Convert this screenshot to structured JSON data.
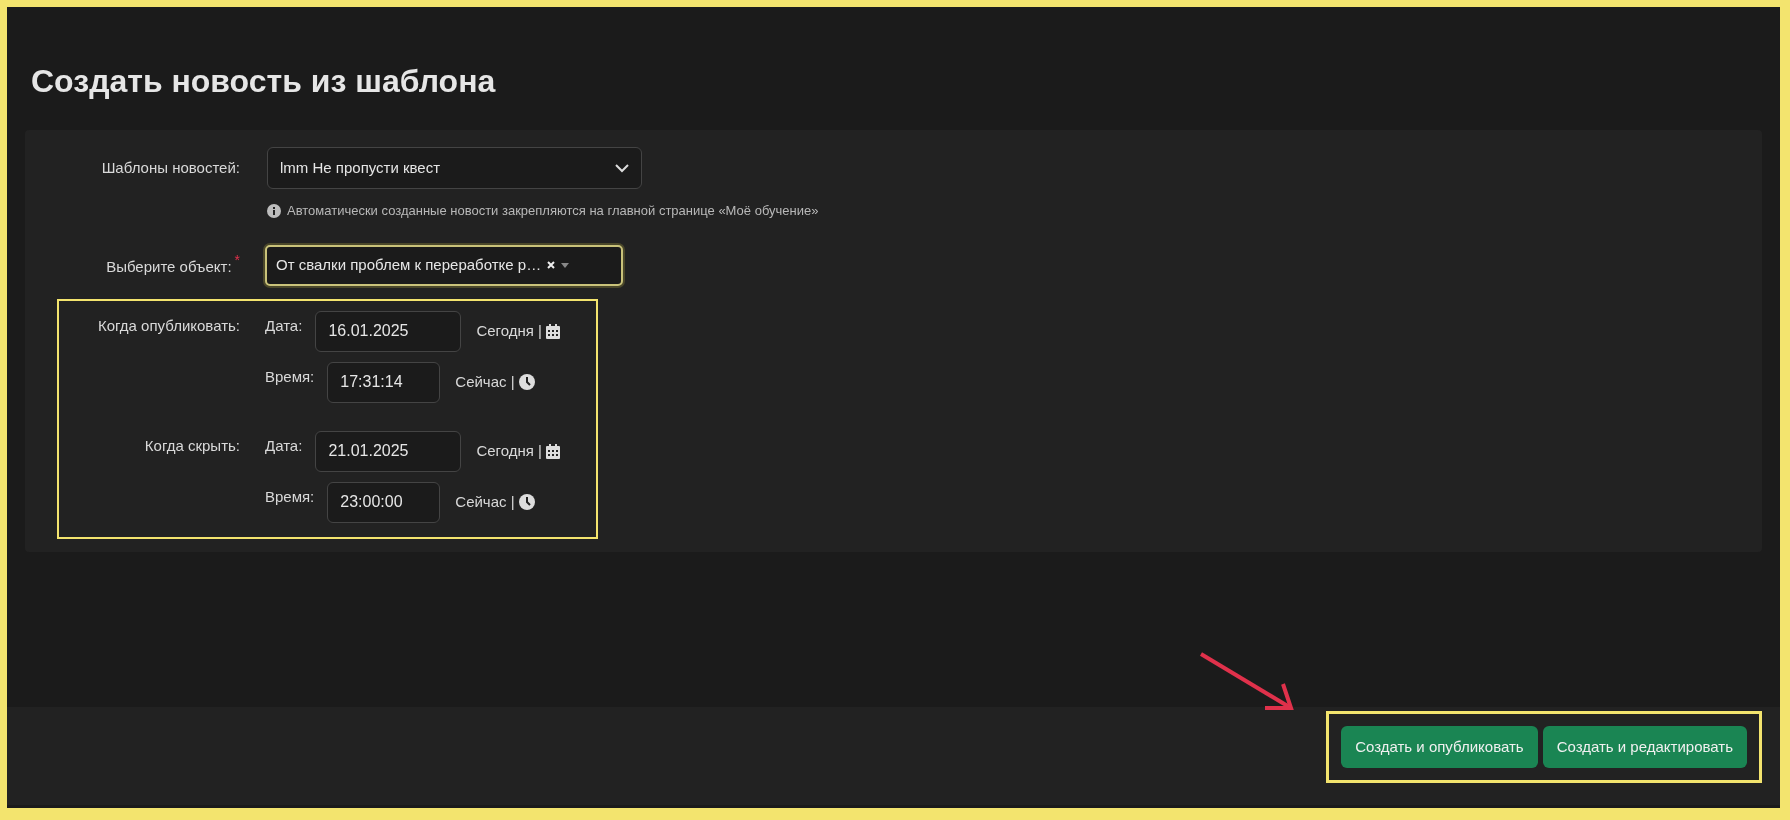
{
  "title": "Создать новость из шаблона",
  "template_field": {
    "label": "Шаблоны новостей:",
    "value": "lmm Не пропусти квест",
    "hint": "Автоматически созданные новости закрепляются на главной странице «Моё обучение»"
  },
  "object_field": {
    "label": "Выберите объект:",
    "required_mark": "*",
    "value": "От свалки проблем к переработке р…",
    "focused": true
  },
  "schedule": [
    {
      "label": "Когда опубликовать:",
      "date_label": "Дата:",
      "date": "16.01.2025",
      "today": "Сегодня |",
      "time_label": "Время:",
      "time": "17:31:14",
      "now": "Сейчас |"
    },
    {
      "label": "Когда скрыть:",
      "date_label": "Дата:",
      "date": "21.01.2025",
      "today": "Сегодня |",
      "time_label": "Время:",
      "time": "23:00:00",
      "now": "Сейчас |"
    }
  ],
  "buttons": [
    "Создать и опубликовать",
    "Создать и редактировать"
  ]
}
